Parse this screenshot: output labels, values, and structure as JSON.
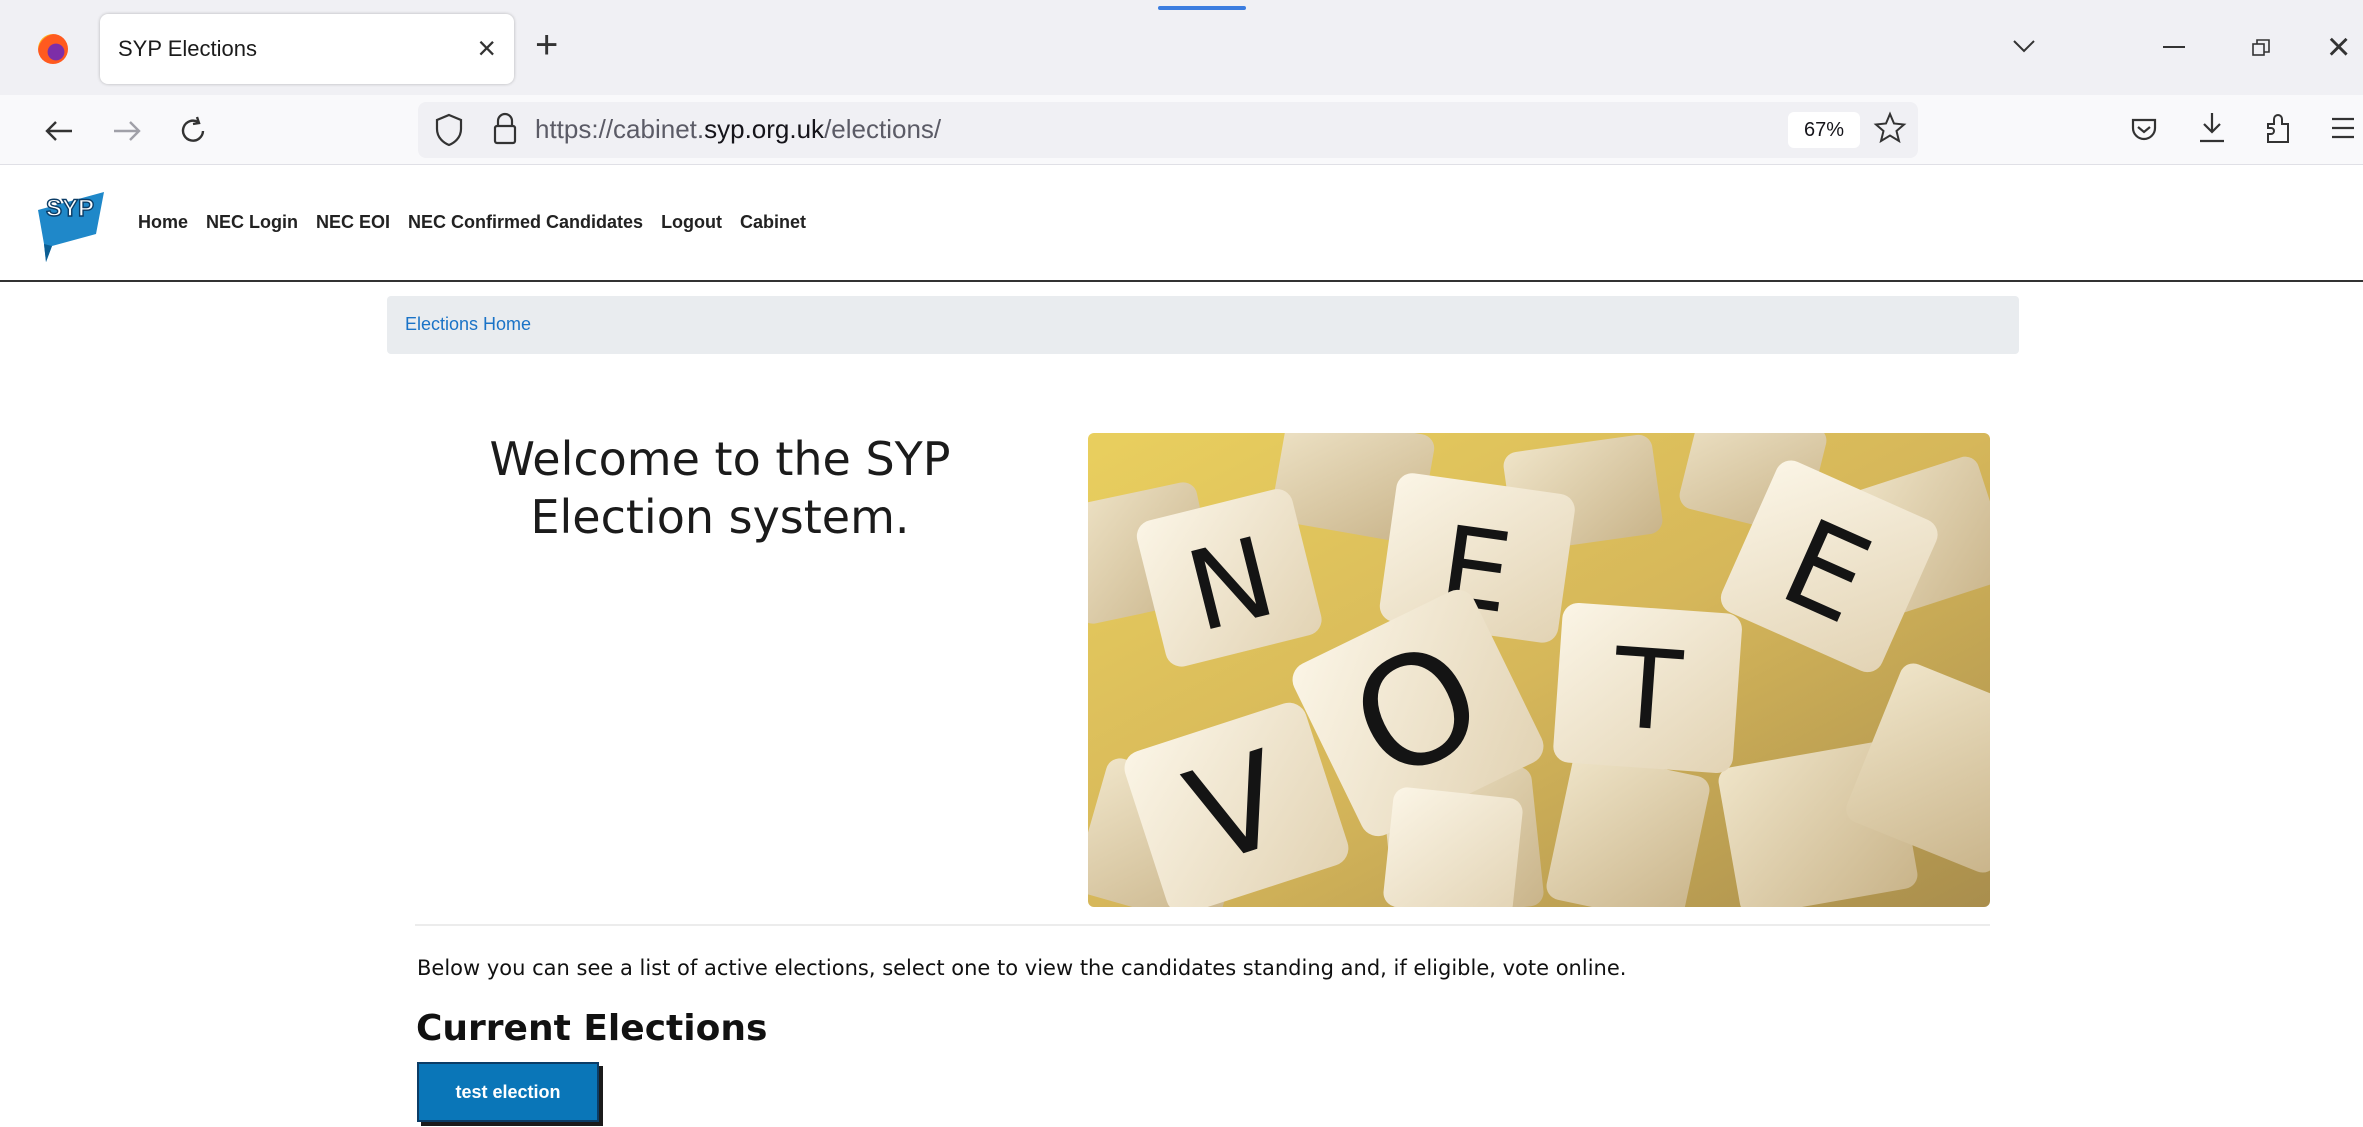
{
  "browser": {
    "tab_title": "SYP Elections",
    "tab_close": "×",
    "new_tab": "+",
    "close_window": "×",
    "url_prefix": "https://cabinet.",
    "url_domain": "syp.org.uk",
    "url_path": "/elections/",
    "zoom": "67%"
  },
  "site": {
    "logo_text": "SYP",
    "nav": [
      "Home",
      "NEC Login",
      "NEC EOI",
      "NEC Confirmed Candidates",
      "Logout",
      "Cabinet"
    ]
  },
  "breadcrumb": {
    "label": "Elections Home"
  },
  "welcome": {
    "line1": "Welcome to the SYP",
    "line2": "Election system."
  },
  "hero": {
    "letters": [
      "N",
      "E",
      "V",
      "O",
      "T",
      "E"
    ]
  },
  "intro_text": "Below you can see a list of active elections, select one to view the candidates standing and, if eligible, vote online.",
  "current_elections": {
    "title": "Current Elections",
    "items": [
      {
        "label": "test election"
      }
    ]
  },
  "colors": {
    "accent": "#0a76b8",
    "breadcrumb_bg": "#e9ecef",
    "link": "#1a73c7"
  }
}
